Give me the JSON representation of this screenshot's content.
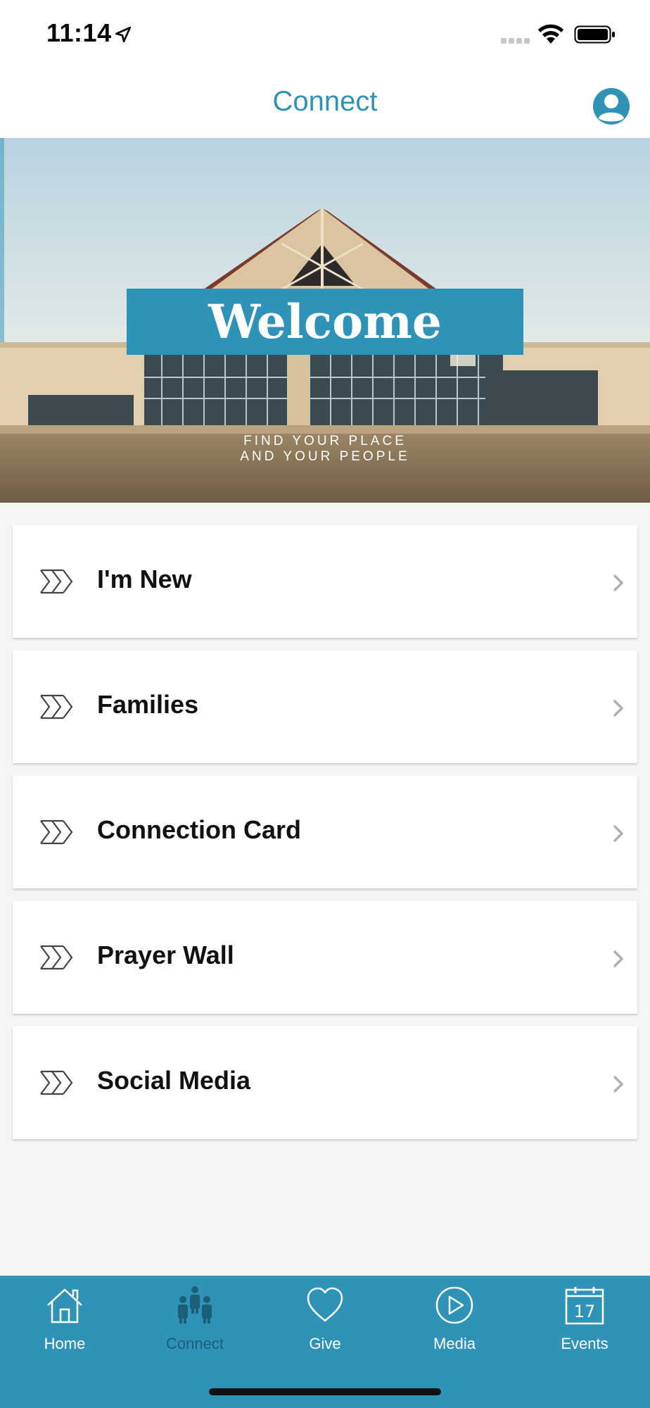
{
  "status_bar": {
    "time": "11:14",
    "icons": [
      "location-arrow-icon",
      "cellular-signal-icon",
      "wifi-icon",
      "battery-icon"
    ]
  },
  "header": {
    "title": "Connect",
    "profile_icon": "user-avatar-icon"
  },
  "hero": {
    "title": "Welcome",
    "subtitle_line1": "FIND YOUR PLACE",
    "subtitle_line2": "AND YOUR PEOPLE"
  },
  "menu": {
    "items": [
      {
        "label": "I'm New",
        "icon": "triple-chevron-icon"
      },
      {
        "label": "Families",
        "icon": "triple-chevron-icon"
      },
      {
        "label": "Connection Card",
        "icon": "triple-chevron-icon"
      },
      {
        "label": "Prayer Wall",
        "icon": "triple-chevron-icon"
      },
      {
        "label": "Social Media",
        "icon": "triple-chevron-icon"
      }
    ]
  },
  "tab_bar": {
    "active": "Connect",
    "tabs": [
      {
        "label": "Home",
        "icon": "home-icon"
      },
      {
        "label": "Connect",
        "icon": "people-icon"
      },
      {
        "label": "Give",
        "icon": "heart-icon"
      },
      {
        "label": "Media",
        "icon": "play-circle-icon"
      },
      {
        "label": "Events",
        "icon": "calendar-icon",
        "date": "17"
      }
    ]
  },
  "colors": {
    "accent": "#2f93b7",
    "active_tab": "#1b5f78",
    "background": "#f5f5f5"
  }
}
